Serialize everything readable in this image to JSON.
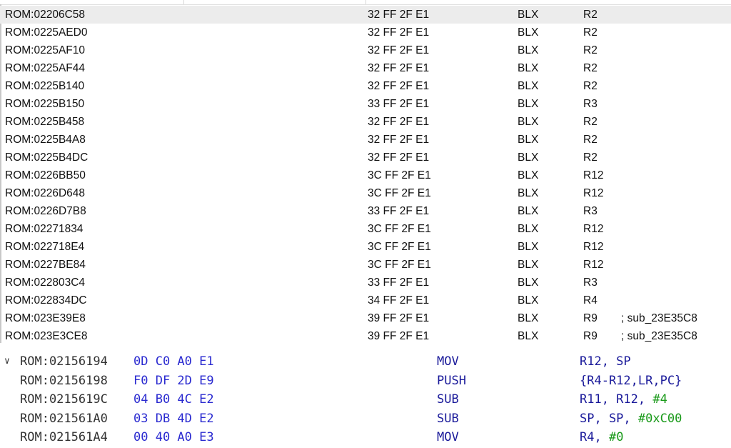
{
  "xrefs": [
    {
      "address": "ROM:02206C58",
      "bytes": "32 FF 2F E1",
      "mnemonic": "BLX",
      "operand": "R2",
      "comment": ""
    },
    {
      "address": "ROM:0225AED0",
      "bytes": "32 FF 2F E1",
      "mnemonic": "BLX",
      "operand": "R2",
      "comment": ""
    },
    {
      "address": "ROM:0225AF10",
      "bytes": "32 FF 2F E1",
      "mnemonic": "BLX",
      "operand": "R2",
      "comment": ""
    },
    {
      "address": "ROM:0225AF44",
      "bytes": "32 FF 2F E1",
      "mnemonic": "BLX",
      "operand": "R2",
      "comment": ""
    },
    {
      "address": "ROM:0225B140",
      "bytes": "32 FF 2F E1",
      "mnemonic": "BLX",
      "operand": "R2",
      "comment": ""
    },
    {
      "address": "ROM:0225B150",
      "bytes": "33 FF 2F E1",
      "mnemonic": "BLX",
      "operand": "R3",
      "comment": ""
    },
    {
      "address": "ROM:0225B458",
      "bytes": "32 FF 2F E1",
      "mnemonic": "BLX",
      "operand": "R2",
      "comment": ""
    },
    {
      "address": "ROM:0225B4A8",
      "bytes": "32 FF 2F E1",
      "mnemonic": "BLX",
      "operand": "R2",
      "comment": ""
    },
    {
      "address": "ROM:0225B4DC",
      "bytes": "32 FF 2F E1",
      "mnemonic": "BLX",
      "operand": "R2",
      "comment": ""
    },
    {
      "address": "ROM:0226BB50",
      "bytes": "3C FF 2F E1",
      "mnemonic": "BLX",
      "operand": "R12",
      "comment": ""
    },
    {
      "address": "ROM:0226D648",
      "bytes": "3C FF 2F E1",
      "mnemonic": "BLX",
      "operand": "R12",
      "comment": ""
    },
    {
      "address": "ROM:0226D7B8",
      "bytes": "33 FF 2F E1",
      "mnemonic": "BLX",
      "operand": "R3",
      "comment": ""
    },
    {
      "address": "ROM:02271834",
      "bytes": "3C FF 2F E1",
      "mnemonic": "BLX",
      "operand": "R12",
      "comment": ""
    },
    {
      "address": "ROM:022718E4",
      "bytes": "3C FF 2F E1",
      "mnemonic": "BLX",
      "operand": "R12",
      "comment": ""
    },
    {
      "address": "ROM:0227BE84",
      "bytes": "3C FF 2F E1",
      "mnemonic": "BLX",
      "operand": "R12",
      "comment": ""
    },
    {
      "address": "ROM:022803C4",
      "bytes": "33 FF 2F E1",
      "mnemonic": "BLX",
      "operand": "R3",
      "comment": ""
    },
    {
      "address": "ROM:022834DC",
      "bytes": "34 FF 2F E1",
      "mnemonic": "BLX",
      "operand": "R4",
      "comment": ""
    },
    {
      "address": "ROM:023E39E8",
      "bytes": "39 FF 2F E1",
      "mnemonic": "BLX",
      "operand": "R9",
      "comment": "; sub_23E35C8"
    },
    {
      "address": "ROM:023E3CE8",
      "bytes": "39 FF 2F E1",
      "mnemonic": "BLX",
      "operand": "R9",
      "comment": "; sub_23E35C8"
    }
  ],
  "disassembly": [
    {
      "address": "ROM:02156194",
      "bytes": "0D C0 A0 E1",
      "mnemonic": "MOV",
      "operand": "R12, SP",
      "imm": ""
    },
    {
      "address": "ROM:02156198",
      "bytes": "F0 DF 2D E9",
      "mnemonic": "PUSH",
      "operand": "{R4-R12,LR,PC}",
      "imm": ""
    },
    {
      "address": "ROM:0215619C",
      "bytes": "04 B0 4C E2",
      "mnemonic": "SUB",
      "operand": "R11, R12, ",
      "imm": "#4"
    },
    {
      "address": "ROM:021561A0",
      "bytes": "03 DB 4D E2",
      "mnemonic": "SUB",
      "operand": "SP, SP, ",
      "imm": "#0xC00"
    },
    {
      "address": "ROM:021561A4",
      "bytes": "00 40 A0 E3",
      "mnemonic": "MOV",
      "operand": "R4, ",
      "imm": "#0"
    }
  ],
  "icons": {
    "collapse": "chevron-down-icon"
  }
}
